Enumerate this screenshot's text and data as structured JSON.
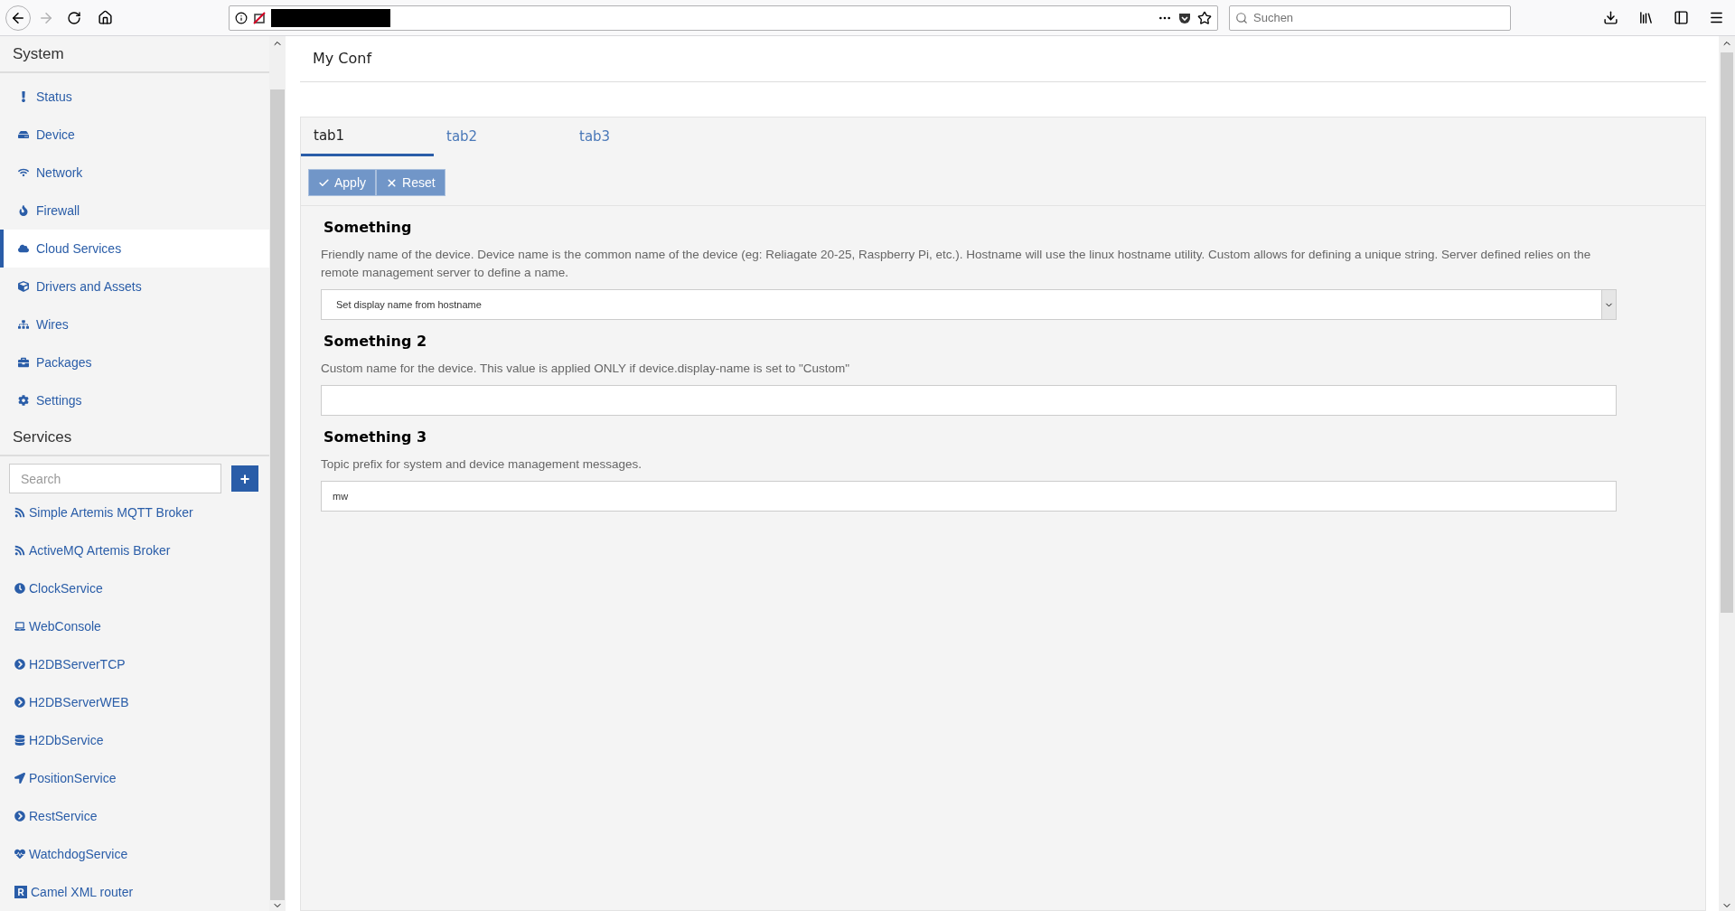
{
  "browser": {
    "search": {
      "placeholder": "Suchen"
    }
  },
  "sidebar": {
    "system": {
      "title": "System",
      "items": [
        {
          "label": "Status",
          "selected": false
        },
        {
          "label": "Device",
          "selected": false
        },
        {
          "label": "Network",
          "selected": false
        },
        {
          "label": "Firewall",
          "selected": false
        },
        {
          "label": "Cloud Services",
          "selected": true
        },
        {
          "label": "Drivers and Assets",
          "selected": false
        },
        {
          "label": "Wires",
          "selected": false
        },
        {
          "label": "Packages",
          "selected": false
        },
        {
          "label": "Settings",
          "selected": false
        }
      ]
    },
    "services": {
      "title": "Services",
      "search": {
        "placeholder": "Search"
      },
      "add_button": "+",
      "items": [
        {
          "label": "Simple Artemis MQTT Broker"
        },
        {
          "label": "ActiveMQ Artemis Broker"
        },
        {
          "label": "ClockService"
        },
        {
          "label": "WebConsole"
        },
        {
          "label": "H2DBServerTCP"
        },
        {
          "label": "H2DBServerWEB"
        },
        {
          "label": "H2DbService"
        },
        {
          "label": "PositionService"
        },
        {
          "label": "RestService"
        },
        {
          "label": "WatchdogService"
        },
        {
          "label": "Camel XML router",
          "icon_text": "R"
        }
      ]
    }
  },
  "main": {
    "title": "My Conf",
    "tabs": [
      {
        "label": "tab1",
        "selected": true
      },
      {
        "label": "tab2",
        "selected": false
      },
      {
        "label": "tab3",
        "selected": false
      }
    ],
    "buttons": [
      {
        "label": "Apply",
        "kind": "apply"
      },
      {
        "label": "Reset",
        "kind": "reset"
      }
    ],
    "fields": [
      {
        "kind": "select",
        "label": "Something",
        "description": "Friendly name of the device. Device name is the common name of the device (eg: Reliagate 20-25, Raspberry Pi, etc.). Hostname will use the linux hostname utility. Custom allows for defining a unique string. Server defined relies on the remote management server to define a name.",
        "value": "Set display name from hostname"
      },
      {
        "kind": "text",
        "label": "Something 2",
        "description": "Custom name for the device. This value is applied ONLY if device.display-name is set to \"Custom\""
      },
      {
        "kind": "text",
        "label": "Something 3",
        "description": "Topic prefix for system and device management messages.",
        "value": "mw"
      }
    ]
  }
}
